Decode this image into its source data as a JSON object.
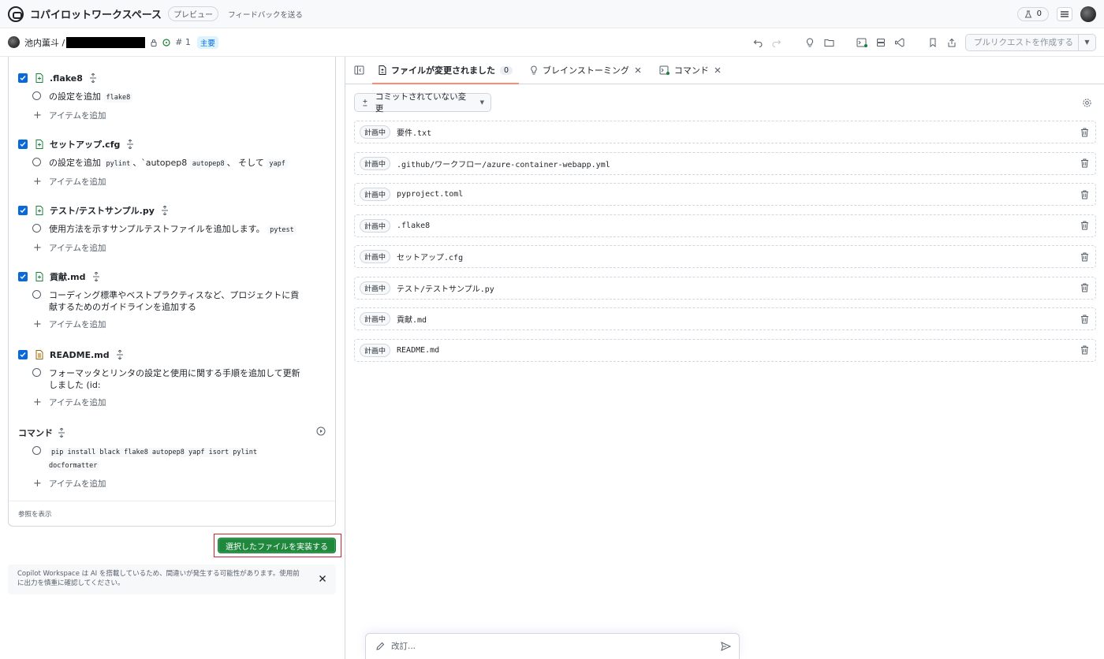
{
  "header": {
    "title": "コパイロットワークスペース",
    "preview_badge": "プレビュー",
    "feedback_link": "フィードバックを送る",
    "counter": "0"
  },
  "subbar": {
    "owner": "池内薫斗 /",
    "issue_number": "# 1",
    "branch_badge": "主要",
    "create_pr_label": "プルリクエストを作成する"
  },
  "plan": {
    "sections": [
      {
        "file": ".flake8",
        "file_icon": "file-added-icon",
        "items": [
          {
            "text": "の設定を追加",
            "code": "flake8"
          }
        ]
      },
      {
        "file": "セットアップ.cfg",
        "file_icon": "file-added-icon",
        "items": [
          {
            "text": "の設定を追加",
            "code": "pylint",
            "text2": "、`autopep8",
            "code2": "autopep8",
            "text3": "、 そして",
            "code3": "yapf"
          }
        ]
      },
      {
        "file": "テスト/テストサンプル.py",
        "file_icon": "file-added-icon",
        "items": [
          {
            "text": "使用方法を示すサンプルテストファイルを追加します。",
            "code": "pytest"
          }
        ]
      },
      {
        "file": "貢献.md",
        "file_icon": "file-added-icon",
        "items": [
          {
            "text": "コーディング標準やベストプラクティスなど、プロジェクトに貢献するためのガイドラインを追加する"
          }
        ]
      },
      {
        "file": "README.md",
        "file_icon": "file-modified-icon",
        "items": [
          {
            "text": "フォーマッタとリンタの設定と使用に関する手順を追加して更新しました (id:"
          }
        ]
      }
    ],
    "add_item_label": "アイテムを追加",
    "commands_label": "コマンド",
    "command_text": "pip install black flake8 autopep8 yapf isort pylint docformatter",
    "show_references": "参照を表示",
    "implement_button": "選択したファイルを実装する",
    "notice": "Copilot Workspace は AI を搭載しているため、間違いが発生する可能性があります。使用前に出力を慎重に確認してください。"
  },
  "tabs": [
    {
      "label": "ファイルが変更されました",
      "count": "0",
      "icon": "file-diff-icon"
    },
    {
      "label": "ブレインストーミング",
      "icon": "lightbulb-icon"
    },
    {
      "label": "コマンド",
      "icon": "terminal-icon"
    }
  ],
  "changes": {
    "dropdown_label": "コミットされていない変更",
    "status_label": "計画中",
    "files": [
      "要件.txt",
      ".github/ワークフロー/azure-container-webapp.yml",
      "pyproject.toml",
      ".flake8",
      "セットアップ.cfg",
      "テスト/テストサンプル.py",
      "貢献.md",
      "README.md"
    ]
  },
  "chat": {
    "placeholder": "改訂..."
  },
  "colors": {
    "accent_blue": "#0969da",
    "primary_green": "#1f883d",
    "tab_underline": "#fd8c73",
    "highlight_red": "#d1242f"
  }
}
